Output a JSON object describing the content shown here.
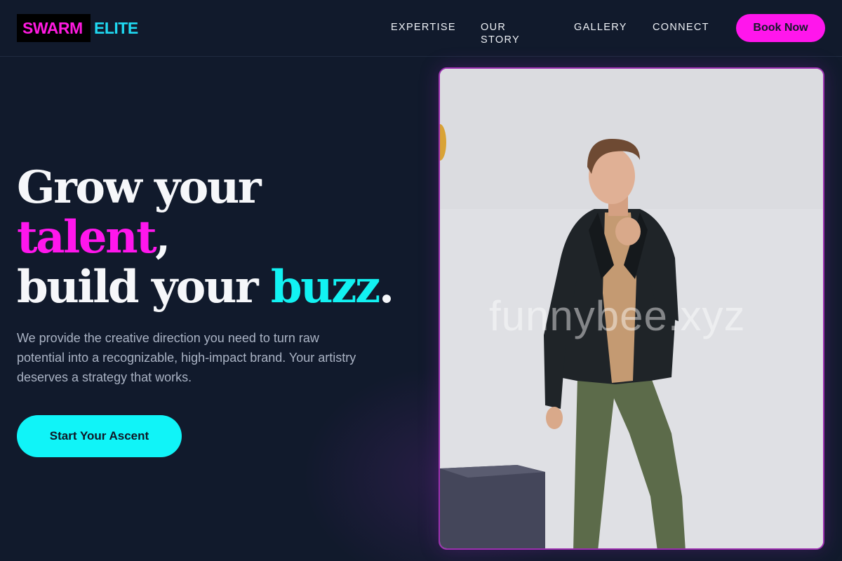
{
  "header": {
    "logo_part1": "SWARM",
    "logo_part2": "ELITE",
    "nav": [
      "EXPERTISE",
      "OUR STORY",
      "GALLERY",
      "CONNECT"
    ],
    "book_label": "Book Now"
  },
  "hero": {
    "line1": "Grow your",
    "line2_accent": "talent",
    "line2_rest": ",",
    "line3_start": "build your ",
    "line3_accent": "buzz",
    "line3_end": ".",
    "description": "We provide the creative direction you need to turn raw potential into a recognizable, high-impact brand. Your artistry deserves a strategy that works.",
    "cta_label": "Start Your Ascent"
  },
  "photo": {
    "watermark": "funnybee.xyz"
  },
  "colors": {
    "background": "#111a2c",
    "magenta": "#ff16ec",
    "cyan": "#12f2f2"
  }
}
